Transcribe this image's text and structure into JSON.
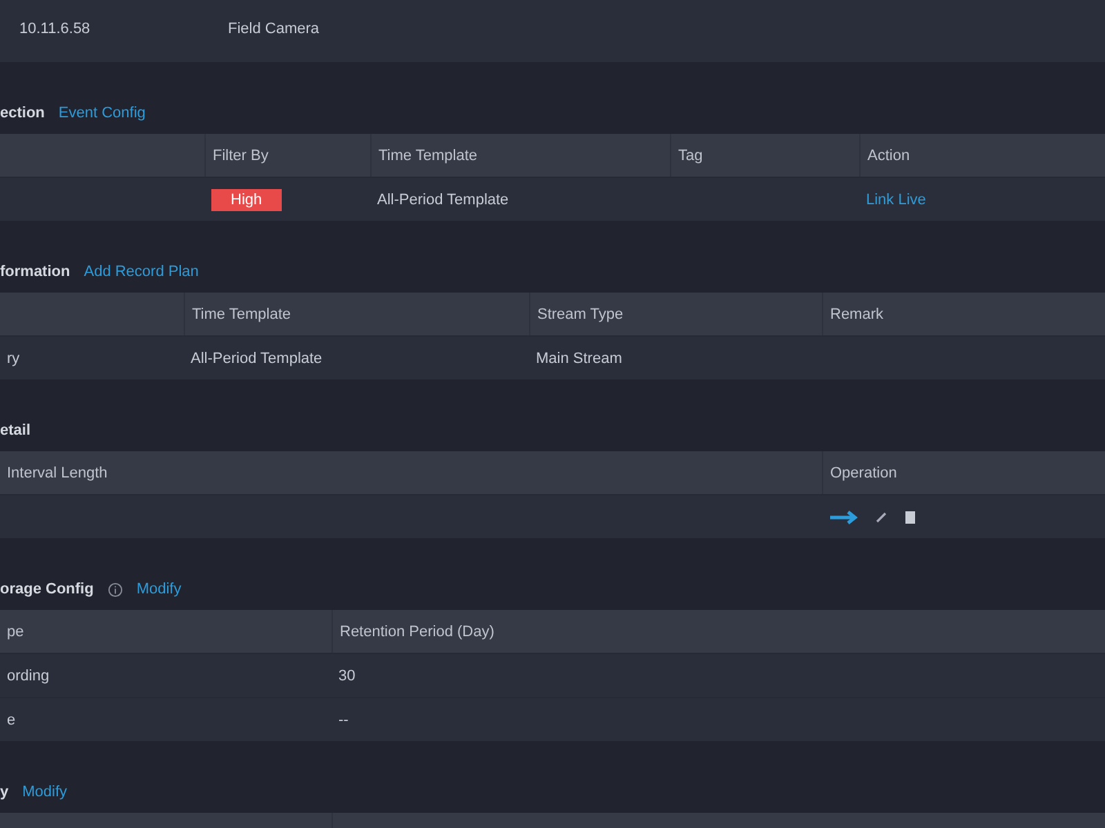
{
  "device_info": {
    "rows": [
      {
        "label": "10.11.6.58",
        "value": "Field Camera"
      }
    ]
  },
  "sections": [
    {
      "title": "ection",
      "link": "Event Config",
      "columns": [
        null,
        "Filter By",
        "Time Template",
        "Tag",
        "Action"
      ],
      "rows": [
        [
          {
            "kind": "empty"
          },
          {
            "kind": "badge",
            "text": "High",
            "color": "#e84a4a"
          },
          {
            "kind": "text",
            "text": "All-Period Template"
          },
          {
            "kind": "empty"
          },
          {
            "kind": "link",
            "text": "Link Live"
          }
        ]
      ]
    },
    {
      "title": "formation",
      "link": "Add Record Plan",
      "columns": [
        null,
        "Time Template",
        "Stream Type",
        "Remark"
      ],
      "rows": [
        [
          {
            "kind": "text",
            "text": "ry"
          },
          {
            "kind": "text",
            "text": "All-Period Template"
          },
          {
            "kind": "text",
            "text": "Main Stream"
          },
          {
            "kind": "empty"
          }
        ]
      ]
    },
    {
      "title": "etail",
      "columns": [
        "Interval Length",
        "Operation"
      ],
      "rows": [
        [
          {
            "kind": "empty"
          },
          {
            "kind": "actions"
          }
        ]
      ]
    },
    {
      "title": "orage Config",
      "link": "Modify",
      "info": true,
      "columns": [
        "pe",
        "Retention Period (Day)"
      ],
      "rows": [
        [
          {
            "kind": "text",
            "text": "ording"
          },
          {
            "kind": "text",
            "text": "30"
          }
        ],
        [
          {
            "kind": "text",
            "text": "e"
          },
          {
            "kind": "text",
            "text": "--"
          }
        ]
      ]
    },
    {
      "title": "y",
      "link": "Modify",
      "columns": [
        null,
        null
      ]
    }
  ]
}
